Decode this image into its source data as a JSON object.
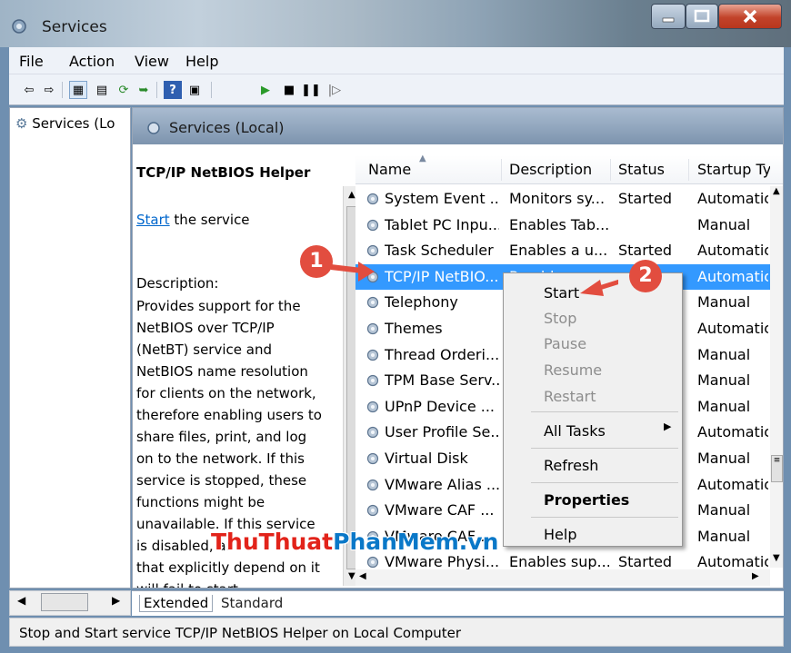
{
  "window": {
    "title": "Services"
  },
  "menu": [
    "File",
    "Action",
    "View",
    "Help"
  ],
  "tree": {
    "item": "Services (Lo"
  },
  "panel": {
    "header": "Services (Local)"
  },
  "details": {
    "service_title": "TCP/IP NetBIOS Helper",
    "start_link": "Start",
    "start_suffix": " the service",
    "description_label": "Description:",
    "description_lines": [
      "Provides support for the",
      "NetBIOS over TCP/IP",
      "(NetBT) service and",
      "NetBIOS name resolution",
      "for clients on the network,",
      "therefore enabling users to",
      "share files, print, and log",
      "on to the network. If this",
      "service is stopped, these",
      "functions might be",
      "unavailable. If this service",
      "is disabled, ar",
      "that explicitly depend on it",
      "will fail to start"
    ]
  },
  "columns": [
    "Name",
    "Description",
    "Status",
    "Startup Ty"
  ],
  "rows": [
    {
      "name": "System Event ...",
      "description": "Monitors sy...",
      "status": "Started",
      "startup": "Automatic"
    },
    {
      "name": "Tablet PC Inpu...",
      "description": "Enables Tab...",
      "status": "",
      "startup": "Manual"
    },
    {
      "name": "Task Scheduler",
      "description": "Enables a u...",
      "status": "Started",
      "startup": "Automatic"
    },
    {
      "name": "TCP/IP NetBIO...",
      "description": "Provides su...",
      "status": "",
      "startup": "Automatic"
    },
    {
      "name": "Telephony",
      "description": "",
      "status": "",
      "startup": "Manual"
    },
    {
      "name": "Themes",
      "description": "",
      "status": "",
      "startup": "Automatic"
    },
    {
      "name": "Thread Orderi...",
      "description": "",
      "status": "",
      "startup": "Manual"
    },
    {
      "name": "TPM Base Serv...",
      "description": "",
      "status": "",
      "startup": "Manual"
    },
    {
      "name": "UPnP Device ...",
      "description": "",
      "status": "",
      "startup": "Manual"
    },
    {
      "name": "User Profile Se...",
      "description": "",
      "status": "",
      "startup": "Automatic"
    },
    {
      "name": "Virtual Disk",
      "description": "",
      "status": "",
      "startup": "Manual"
    },
    {
      "name": "VMware Alias ...",
      "description": "",
      "status": "",
      "startup": "Automatic"
    },
    {
      "name": "VMware CAF ...",
      "description": "",
      "status": "",
      "startup": "Manual"
    },
    {
      "name": "VMware CAF ...",
      "description": "",
      "status": "",
      "startup": "Manual"
    },
    {
      "name": "VMware Physi...",
      "description": "Enables sup...",
      "status": "Started",
      "startup": "Automatic"
    }
  ],
  "context_menu": {
    "start": "Start",
    "stop": "Stop",
    "pause": "Pause",
    "resume": "Resume",
    "restart": "Restart",
    "all_tasks": "All Tasks",
    "refresh": "Refresh",
    "properties": "Properties",
    "help": "Help"
  },
  "annotations": {
    "step1": "1",
    "step2": "2",
    "color": "#e24d3f"
  },
  "tabs": [
    "Extended",
    "Standard"
  ],
  "status_bar": "Stop and Start service TCP/IP NetBIOS Helper on Local Computer",
  "watermark": {
    "part1": "ThuThuat",
    "part2": "PhanMem",
    "part3": ".vn"
  },
  "colors": {
    "selection": "#3399ff",
    "link": "#0066cc",
    "close_button": "#c2432a"
  },
  "icons": [
    "services-gear-icon",
    "back-arrow-icon",
    "forward-arrow-icon",
    "play-icon",
    "stop-icon",
    "pause-icon",
    "resume-icon"
  ]
}
